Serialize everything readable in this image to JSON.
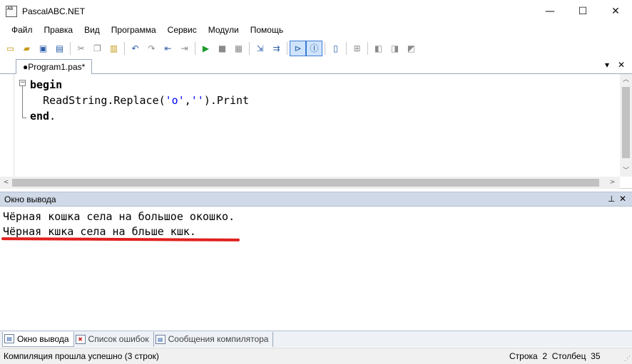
{
  "window": {
    "title": "PascalABC.NET",
    "icon_text": "AB",
    "controls": {
      "minimize": "—",
      "maximize": "☐",
      "close": "✕"
    }
  },
  "menu": {
    "items": [
      "Файл",
      "Правка",
      "Вид",
      "Программа",
      "Сервис",
      "Модули",
      "Помощь"
    ]
  },
  "toolbar": {
    "icons": [
      "new-file-icon",
      "open-icon",
      "save-icon",
      "save-all-icon",
      "cut-icon",
      "copy-icon",
      "paste-icon",
      "undo-icon",
      "redo-icon",
      "navigate-back-icon",
      "navigate-forward-icon",
      "run-icon",
      "stop-icon",
      "compile-icon",
      "debug-step-icon",
      "step-over-icon",
      "output-window-icon",
      "immediate-window-icon",
      "form-designer-icon",
      "module-icon",
      "doc-1-icon",
      "doc-2-icon",
      "doc-3-icon"
    ]
  },
  "document": {
    "tab_label": "●Program1.pas*",
    "dropdown": "▾",
    "close": "✕"
  },
  "editor": {
    "lines": [
      {
        "kw": "begin",
        "rest": ""
      },
      {
        "kw": "",
        "indent": "  ",
        "pre": "ReadString.Replace(",
        "s1": "'o'",
        "mid": ",",
        "s2": "''",
        "post": ").Print"
      },
      {
        "kw": "end",
        "rest": "."
      }
    ]
  },
  "output": {
    "title": "Окно вывода",
    "pin": "⊥",
    "close": "✕",
    "lines": [
      "Чёрная кошка села на большое окошко.",
      "Чёрная кшка села на бльше кшк."
    ],
    "highlight_color": "#e0201e"
  },
  "bottom_tabs": [
    {
      "label": "Окно вывода",
      "icon": "output-window-icon",
      "active": true
    },
    {
      "label": "Список ошибок",
      "icon": "error-list-icon",
      "active": false
    },
    {
      "label": "Сообщения компилятора",
      "icon": "compiler-messages-icon",
      "active": false
    }
  ],
  "status": {
    "message": "Компиляция прошла успешно (3 строк)",
    "row_label": "Строка",
    "row": "2",
    "col_label": "Столбец",
    "col": "35"
  }
}
